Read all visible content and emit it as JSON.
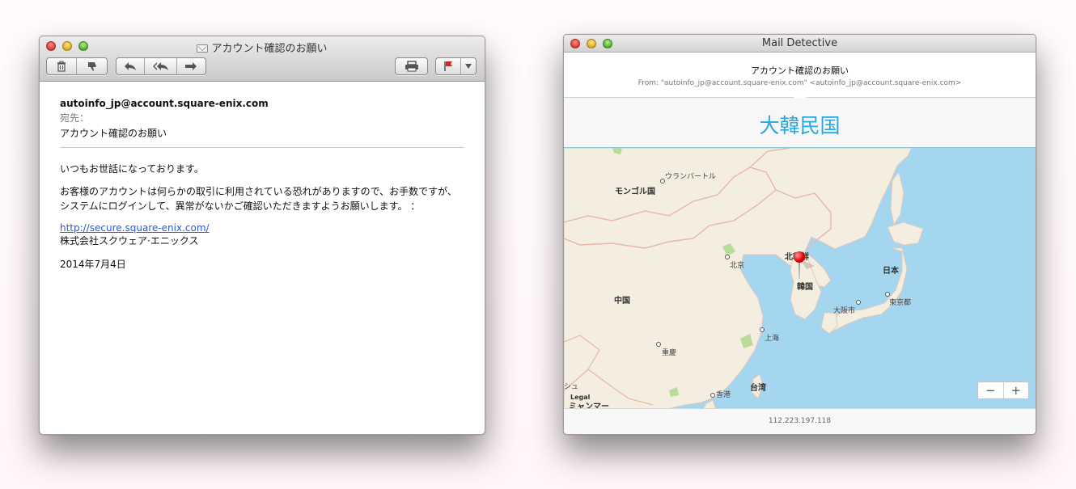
{
  "mail_window": {
    "title": "アカウント確認のお願い",
    "toolbar": {
      "delete_icon": "trash-icon",
      "junk_icon": "thumbs-down-icon",
      "reply_icon": "reply-icon",
      "reply_all_icon": "reply-all-icon",
      "forward_icon": "forward-icon",
      "print_icon": "printer-icon",
      "flag_icon": "flag-icon"
    },
    "from": "autoinfo_jp@account.square-enix.com",
    "to_label": "宛先：",
    "subject": "アカウント確認のお願い",
    "body": {
      "greeting": "いつもお世話になっております。",
      "para1_line1": "お客様のアカウントは何らかの取引に利用されている恐れがありますので、お手数ですが、",
      "para1_line2": "システムにログインして、異常がないかご確認いただきますようお願いします。 ：",
      "link": "http://secure.square-enix.com/",
      "company": "株式会社スクウェア·エニックス",
      "date": "2014年7月4日"
    }
  },
  "detective_window": {
    "title": "Mail Detective",
    "subject": "アカウント確認のお願い",
    "from_line": "From: \"autoinfo_jp@account.square-enix.com\" <autoinfo_jp@account.square-enix.com>",
    "country": "大韓民国",
    "map": {
      "labels": {
        "ulaanbaatar": "ウランバートル",
        "mongolia": "モンゴル国",
        "beijing": "北京",
        "north_korea": "北朝鮮",
        "korea": "韓国",
        "japan": "日本",
        "tokyo": "東京都",
        "osaka": "大阪市",
        "china": "中国",
        "shanghai": "上海",
        "chongqing": "重慶",
        "taiwan": "台湾",
        "hongkong": "香港",
        "legal": "Legal",
        "myanmar": "ミャンマー",
        "shu": "シュ"
      },
      "zoom_out": "−",
      "zoom_in": "+"
    },
    "ip": "112.223.197.118"
  }
}
